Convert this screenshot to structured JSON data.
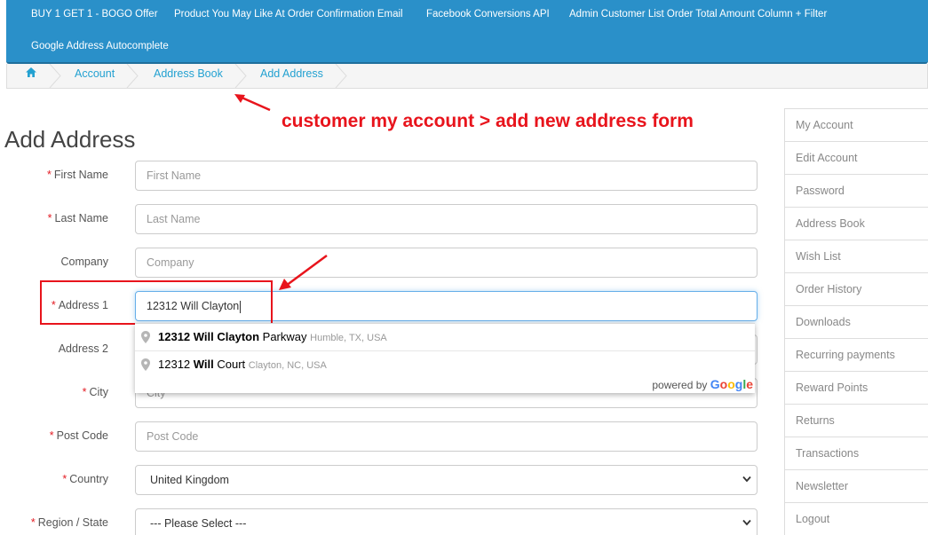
{
  "topnav": {
    "items": [
      "BUY 1 GET 1 - BOGO Offer",
      "Product You May Like At Order Confirmation Email",
      "Facebook Conversions API",
      "Admin Customer List Order Total Amount Column + Filter",
      "Google Address Autocomplete"
    ]
  },
  "breadcrumb": {
    "items": [
      "Account",
      "Address Book",
      "Add Address"
    ]
  },
  "annotation": {
    "text": "customer my account > add new address form"
  },
  "page": {
    "title": "Add Address"
  },
  "form": {
    "first_name": {
      "label": "First Name",
      "placeholder": "First Name"
    },
    "last_name": {
      "label": "Last Name",
      "placeholder": "Last Name"
    },
    "company": {
      "label": "Company",
      "placeholder": "Company"
    },
    "address1": {
      "label": "Address 1",
      "value": "12312 Will Clayton"
    },
    "address2": {
      "label": "Address 2"
    },
    "city": {
      "label": "City",
      "placeholder": "City"
    },
    "postcode": {
      "label": "Post Code",
      "placeholder": "Post Code"
    },
    "country": {
      "label": "Country",
      "value": "United Kingdom"
    },
    "region": {
      "label": "Region / State",
      "value": "--- Please Select ---"
    }
  },
  "autocomplete": {
    "suggestions": [
      {
        "match": "12312 Will Clayton",
        "rest": " Parkway",
        "secondary": "Humble, TX, USA"
      },
      {
        "match_a": "12312 ",
        "match_b": "Will",
        "rest": " Court",
        "secondary": "Clayton, NC, USA"
      }
    ],
    "powered_by": "powered by",
    "google": [
      "G",
      "o",
      "o",
      "g",
      "l",
      "e"
    ]
  },
  "menu": {
    "items": [
      "My Account",
      "Edit Account",
      "Password",
      "Address Book",
      "Wish List",
      "Order History",
      "Downloads",
      "Recurring payments",
      "Reward Points",
      "Returns",
      "Transactions",
      "Newsletter",
      "Logout"
    ]
  },
  "colors": {
    "nav": "#2a90c9",
    "link": "#23a1d1",
    "annotation": "#e8141c",
    "required": "#e31b23"
  }
}
